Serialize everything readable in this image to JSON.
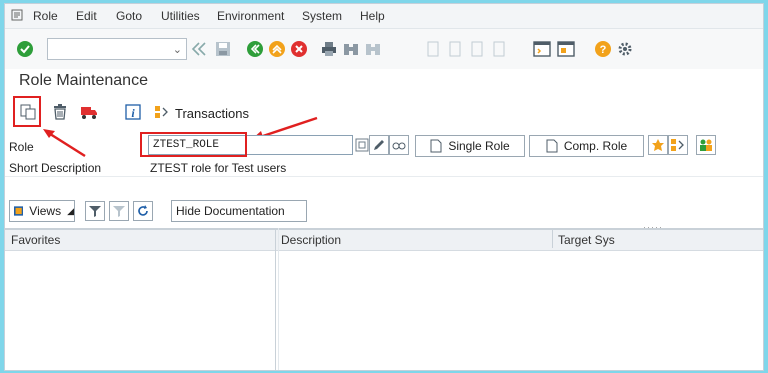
{
  "menu": [
    "Role",
    "Edit",
    "Goto",
    "Utilities",
    "Environment",
    "System",
    "Help"
  ],
  "page_title": "Role Maintenance",
  "app_toolbar": {
    "transactions_label": "Transactions"
  },
  "form": {
    "role_label": "Role",
    "role_value": "ZTEST_ROLE",
    "short_desc_label": "Short Description",
    "short_desc_value": "ZTEST role for Test users"
  },
  "role_buttons": {
    "single_role": "Single Role",
    "comp_role": "Comp. Role"
  },
  "grid_toolbar": {
    "views_label": "Views",
    "hide_doc_label": "Hide Documentation"
  },
  "grid": {
    "columns": [
      "Favorites",
      "Description",
      "Target Sys"
    ]
  },
  "colors": {
    "highlight": "#e02020",
    "background": "#7fd6ea",
    "ok_green": "#2e9e3a",
    "cancel_red": "#e03030"
  }
}
